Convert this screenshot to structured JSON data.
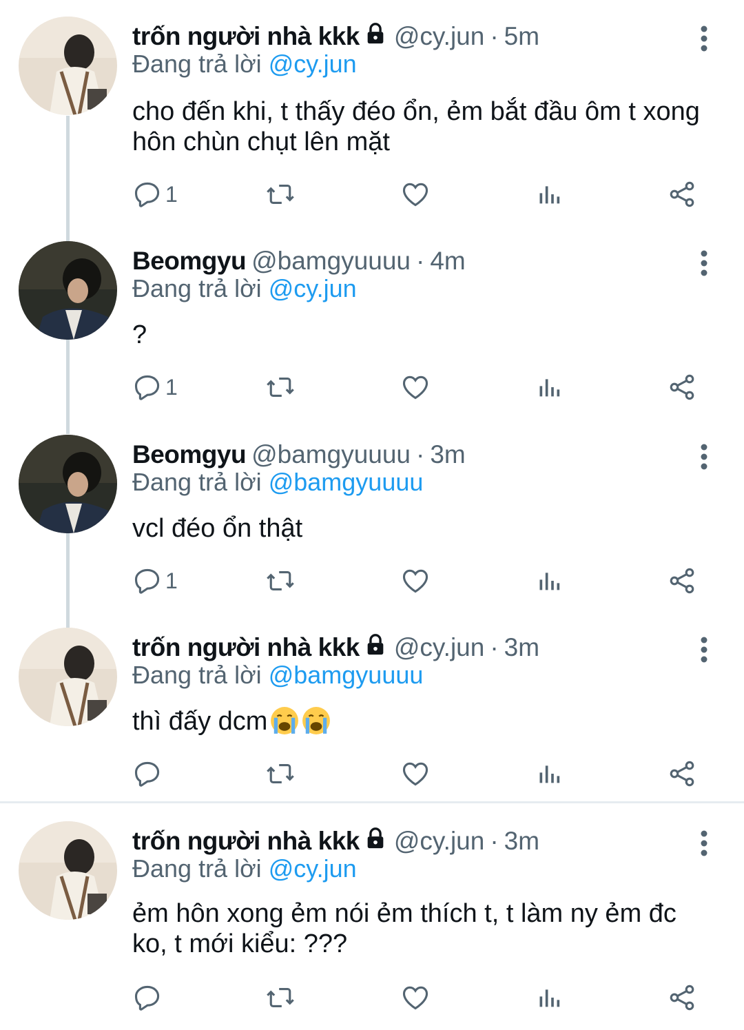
{
  "tweets": [
    {
      "name": "trốn người nhà kkk",
      "locked": true,
      "handle": "@cy.jun",
      "sep": "·",
      "time": "5m",
      "reply_prefix": "Đang trả lời",
      "reply_to": "@cy.jun",
      "text_lines": [
        "cho đến khi, t thấy đéo ổn, ẻm bắt đầu ôm t xong",
        "hôn chùn chụt lên mặt"
      ],
      "reply_count": "1",
      "avatar": "cy-jun-avatar"
    },
    {
      "name": "Beomgyu",
      "locked": false,
      "handle": "@bamgyuuuu",
      "sep": "·",
      "time": "4m",
      "reply_prefix": "Đang trả lời",
      "reply_to": "@cy.jun",
      "text_lines": [
        "?"
      ],
      "reply_count": "1",
      "avatar": "beomgyu-avatar"
    },
    {
      "name": "Beomgyu",
      "locked": false,
      "handle": "@bamgyuuuu",
      "sep": "·",
      "time": "3m",
      "reply_prefix": "Đang trả lời",
      "reply_to": "@bamgyuuuu",
      "text_lines": [
        "vcl đéo ổn thật"
      ],
      "reply_count": "1",
      "avatar": "beomgyu-avatar"
    },
    {
      "name": "trốn người nhà kkk",
      "locked": true,
      "handle": "@cy.jun",
      "sep": "·",
      "time": "3m",
      "reply_prefix": "Đang trả lời",
      "reply_to": "@bamgyuuuu",
      "text_lines": [
        "thì đấy dcm"
      ],
      "emojis": [
        "loudly-crying-face-emoji",
        "loudly-crying-face-emoji"
      ],
      "reply_count": "",
      "avatar": "cy-jun-avatar"
    },
    {
      "name": "trốn người nhà kkk",
      "locked": true,
      "handle": "@cy.jun",
      "sep": "·",
      "time": "3m",
      "reply_prefix": "Đang trả lời",
      "reply_to": "@cy.jun",
      "text_lines": [
        "ẻm hôn xong ẻm nói ẻm thích t, t làm ny ẻm đc",
        "ko, t mới kiểu: ???"
      ],
      "reply_count": "",
      "avatar": "cy-jun-avatar"
    }
  ],
  "colors": {
    "text": "#0f1419",
    "secondary": "#536471",
    "link": "#1d9bf0",
    "thread_line": "#cfd9de",
    "divider": "#e6ecf0"
  },
  "icons": [
    "reply-icon",
    "retweet-icon",
    "like-icon",
    "analytics-icon",
    "share-icon",
    "more-icon",
    "lock-icon"
  ]
}
